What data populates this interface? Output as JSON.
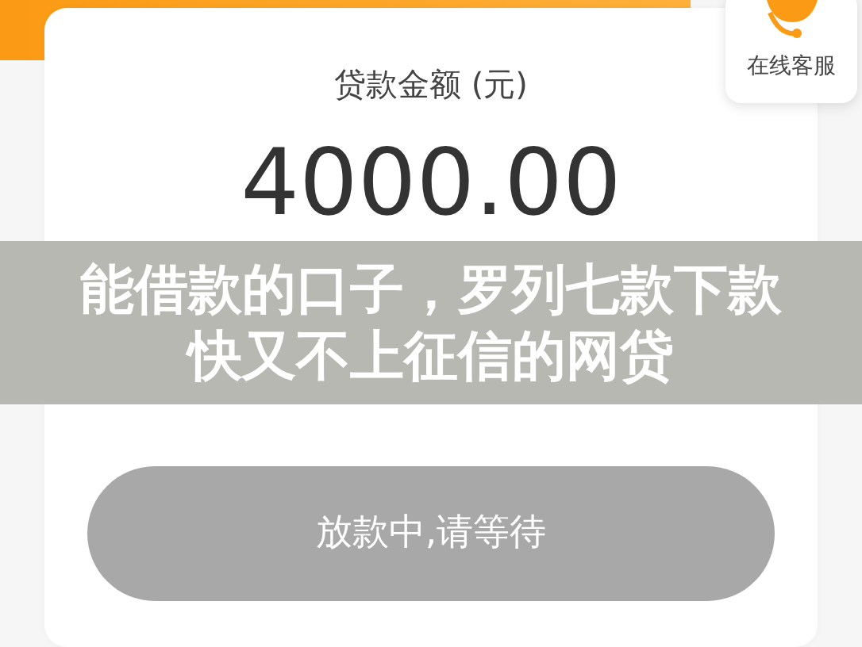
{
  "service": {
    "label": "在线客服"
  },
  "loan": {
    "label": "贷款金额 (元)",
    "amount": "4000.00"
  },
  "status_button": {
    "label": "放款中,请等待",
    "disabled": true
  },
  "overlay_title": {
    "lines": [
      "能借款的口子，罗列七款下款",
      "快又不上征信的网贷"
    ]
  }
}
